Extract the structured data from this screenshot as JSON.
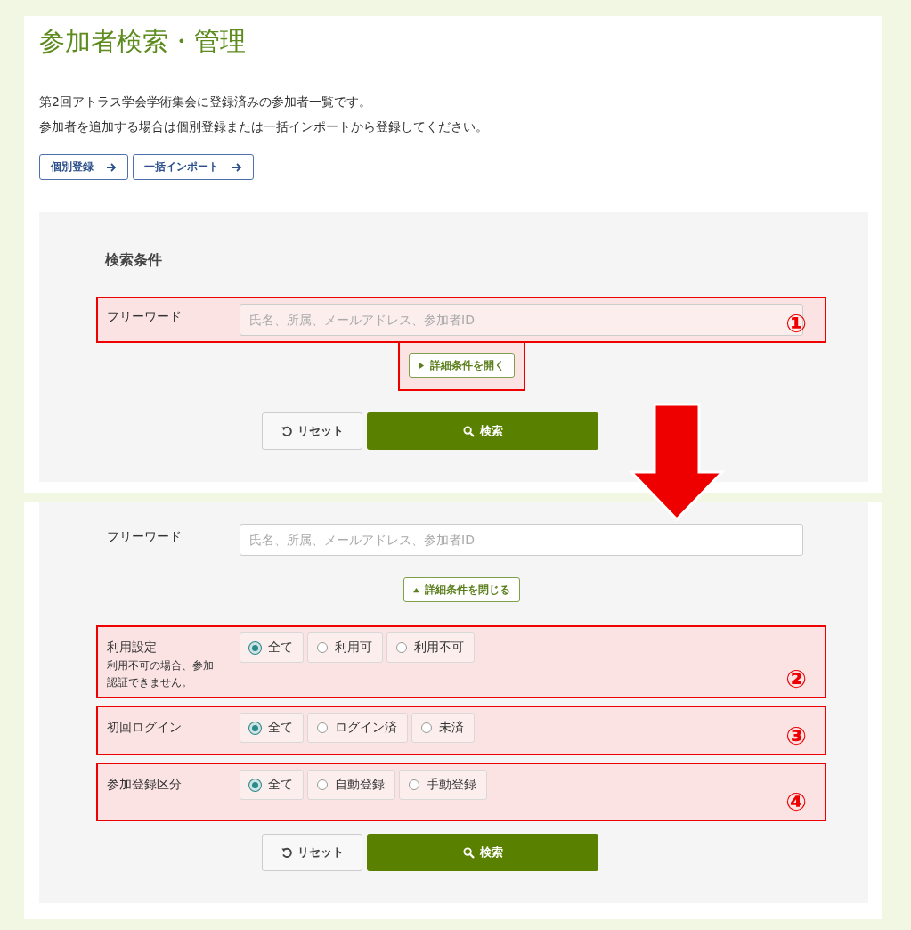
{
  "page": {
    "title": "参加者検索・管理",
    "description": [
      "第2回アトラス学会学術集会に登録済みの参加者一覧です。",
      "参加者を追加する場合は個別登録または一括インポートから登録してください。"
    ],
    "links": [
      {
        "label": "個別登録"
      },
      {
        "label": "一括インポート"
      }
    ]
  },
  "search_panel": {
    "heading": "検索条件",
    "free_word": {
      "label": "フリーワード",
      "placeholder": "氏名、所属、メールアドレス、参加者ID",
      "callout": "①"
    },
    "toggle": {
      "label": "詳細条件を開く",
      "expanded": false,
      "highlighted": true
    },
    "reset": "リセット",
    "search": "検索"
  },
  "expanded_panel": {
    "free_word": {
      "label": "フリーワード",
      "placeholder": "氏名、所属、メールアドレス、参加者ID"
    },
    "toggle": {
      "label": "詳細条件を閉じる",
      "expanded": true,
      "highlighted": false
    },
    "filters": [
      {
        "label": "利用設定",
        "note": "利用不可の場合、参加認証できません。",
        "callout": "②",
        "options": [
          {
            "label": "全て",
            "selected": true
          },
          {
            "label": "利用可",
            "selected": false
          },
          {
            "label": "利用不可",
            "selected": false
          }
        ]
      },
      {
        "label": "初回ログイン",
        "callout": "③",
        "options": [
          {
            "label": "全て",
            "selected": true
          },
          {
            "label": "ログイン済",
            "selected": false
          },
          {
            "label": "未済",
            "selected": false
          }
        ]
      },
      {
        "label": "参加登録区分",
        "callout": "④",
        "options": [
          {
            "label": "全て",
            "selected": true
          },
          {
            "label": "自動登録",
            "selected": false
          },
          {
            "label": "手動登録",
            "selected": false
          }
        ]
      }
    ],
    "reset": "リセット",
    "search": "検索"
  }
}
